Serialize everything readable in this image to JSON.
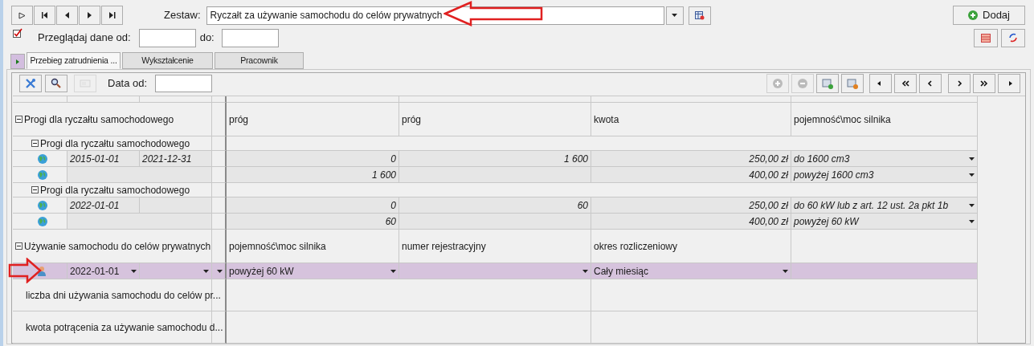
{
  "header": {
    "set_label": "Zestaw:",
    "set_value": "Ryczałt za używanie samochodu do celów prywatnych",
    "browse_label": "Przeglądaj dane od:",
    "to_label": "do:",
    "add_button": "Dodaj"
  },
  "tabs": [
    {
      "label": "Przebieg zatrudnienia ...",
      "selected": true
    },
    {
      "label": "Wykształcenie",
      "selected": false
    },
    {
      "label": "Pracownik",
      "selected": false
    }
  ],
  "grid_toolbar": {
    "date_label": "Data od:",
    "left_buttons": [
      {
        "kind": "tools",
        "disabled": false
      },
      {
        "kind": "search",
        "disabled": false
      },
      {
        "kind": "card",
        "disabled": true
      }
    ],
    "right_buttons": [
      {
        "kind": "plus",
        "disabled": true
      },
      {
        "kind": "minus",
        "disabled": true
      },
      {
        "kind": "add-sheet",
        "disabled": false
      },
      {
        "kind": "remove-sheet",
        "disabled": false
      }
    ]
  },
  "sections": [
    {
      "kind": "thresholds",
      "title": "Progi dla ryczałtu samochodowego",
      "columns": [
        "próg",
        "próg",
        "kwota",
        "pojemność\\moc silnika"
      ],
      "groups": [
        {
          "title": "Progi dla ryczałtu samochodowego",
          "rows": [
            {
              "date_from": "2015-01-01",
              "date_to": "2021-12-31",
              "threshold_1": "0",
              "threshold_2": "1 600",
              "amount": "250,00 zł",
              "engine": "do 1600 cm3"
            },
            {
              "threshold_1": "1 600",
              "amount": "400,00 zł",
              "engine": "powyżej 1600 cm3"
            }
          ]
        },
        {
          "title": "Progi dla ryczałtu samochodowego",
          "rows": [
            {
              "date_from": "2022-01-01",
              "threshold_1": "0",
              "threshold_2": "60",
              "amount": "250,00 zł",
              "engine": "do 60 kW lub z art. 12 ust. 2a pkt 1b"
            },
            {
              "threshold_1": "60",
              "amount": "400,00 zł",
              "engine": "powyżej 60 kW"
            }
          ]
        }
      ]
    },
    {
      "kind": "usage",
      "title": "Używanie samochodu do celów prywatnych",
      "columns": [
        "pojemność\\moc silnika",
        "numer rejestracyjny",
        "okres rozliczeniowy"
      ],
      "record": {
        "selected": true,
        "date_from": "2022-01-01",
        "values": [
          {
            "text": "powyżej 60 kW",
            "dropdown": true
          },
          {
            "dropdown": true
          },
          {
            "text": "Cały miesiąc",
            "dropdown": true
          },
          {
            "dropdown": false
          }
        ]
      },
      "fields": [
        "liczba dni używania samochodu do celów pr...",
        "kwota potrącenia za używanie samochodu d..."
      ]
    }
  ]
}
